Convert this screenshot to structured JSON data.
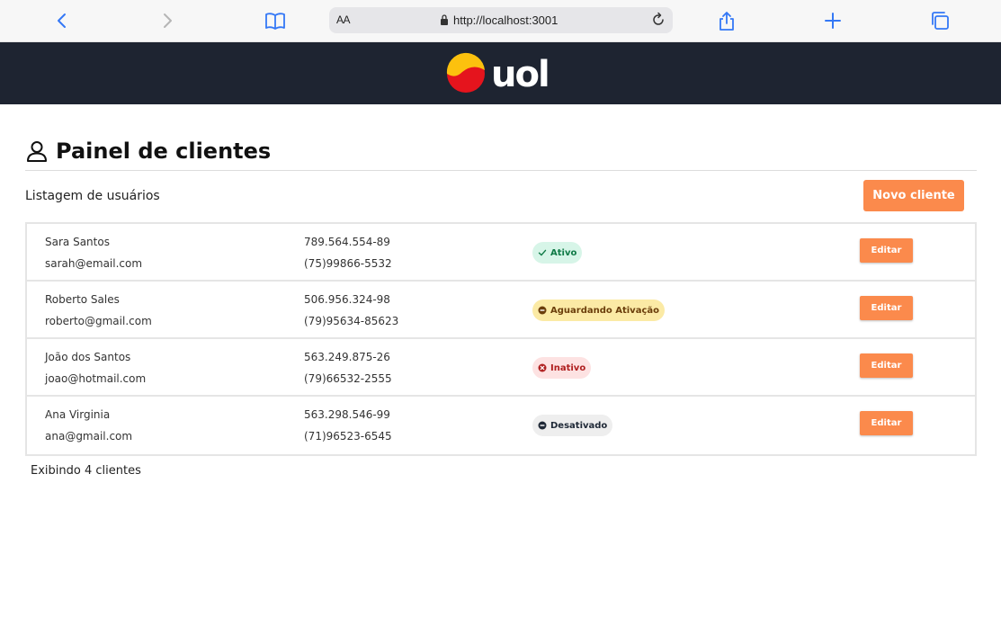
{
  "browser": {
    "text_size_label": "AA",
    "url": "http://localhost:3001"
  },
  "header": {
    "logo_text": "uol"
  },
  "page": {
    "title": "Painel de clientes",
    "subtitle": "Listagem de usuários",
    "new_client_label": "Novo cliente",
    "footer_count": "Exibindo 4 clientes"
  },
  "colors": {
    "header_bg": "#1e2431",
    "accent": "#fb8a4c",
    "status_active_bg": "#d7f5e8",
    "status_active_fg": "#0f7a46",
    "status_waiting_bg": "#fbeaa5",
    "status_waiting_fg": "#6b3e0b",
    "status_inactive_bg": "#fde2e2",
    "status_inactive_fg": "#b02020",
    "status_disabled_bg": "#eeeeee",
    "status_disabled_fg": "#1f2937"
  },
  "clients": [
    {
      "name": "Sara Santos",
      "email": "sarah@email.com",
      "document": "789.564.554-89",
      "phone": "(75)99866-5532",
      "status": "Ativo",
      "status_icon": "check-icon",
      "edit_label": "Editar"
    },
    {
      "name": "Roberto Sales",
      "email": "roberto@gmail.com",
      "document": "506.956.324-98",
      "phone": "(79)95634-85623",
      "status": "Aguardando Ativação",
      "status_icon": "minus-circle-icon",
      "edit_label": "Editar"
    },
    {
      "name": "João dos Santos",
      "email": "joao@hotmail.com",
      "document": "563.249.875-26",
      "phone": "(79)66532-2555",
      "status": "Inativo",
      "status_icon": "x-circle-icon",
      "edit_label": "Editar"
    },
    {
      "name": "Ana Virginia",
      "email": "ana@gmail.com",
      "document": "563.298.546-99",
      "phone": "(71)96523-6545",
      "status": "Desativado",
      "status_icon": "minus-circle-icon",
      "edit_label": "Editar"
    }
  ]
}
